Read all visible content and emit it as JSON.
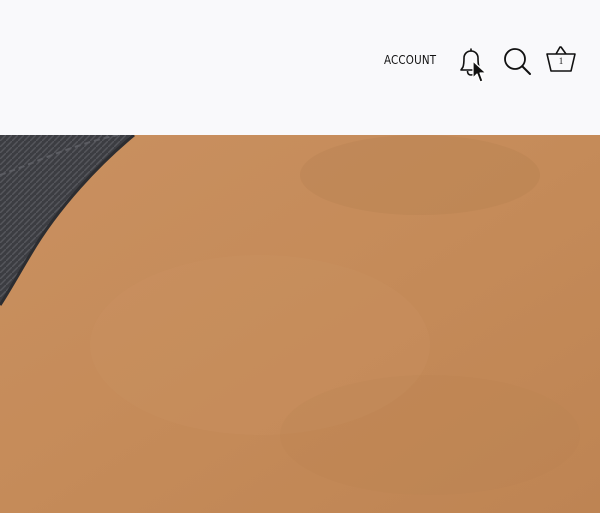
{
  "header": {
    "account_label": "ACCOUNT",
    "icons": {
      "notifications": "bell-icon",
      "search": "search-icon",
      "cart": "basket-icon"
    },
    "cart_count": "1"
  },
  "hero": {
    "background_color": "#c18a5a",
    "strap_color": "#3c3d42"
  }
}
